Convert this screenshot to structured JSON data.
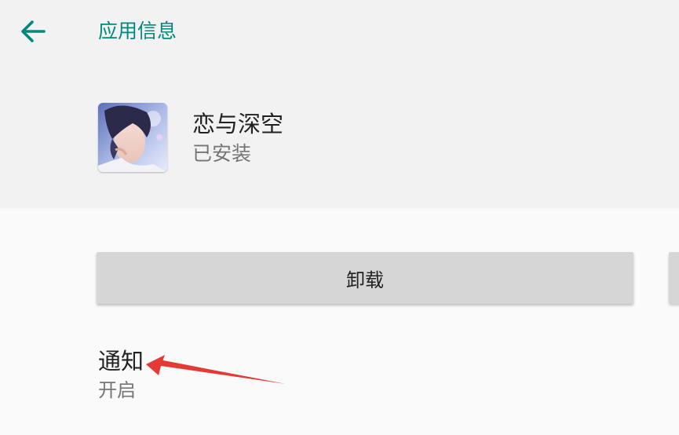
{
  "header": {
    "back_icon": "arrow-left-icon",
    "title": "应用信息",
    "accent_color": "#00897b"
  },
  "app": {
    "name": "恋与深空",
    "status": "已安装",
    "icon": "app-portrait-icon"
  },
  "actions": {
    "uninstall_label": "卸载"
  },
  "settings": {
    "notifications": {
      "label": "通知",
      "value": "开启"
    }
  },
  "annotation": {
    "arrow_color": "#e53935",
    "icon": "red-arrow-icon"
  }
}
